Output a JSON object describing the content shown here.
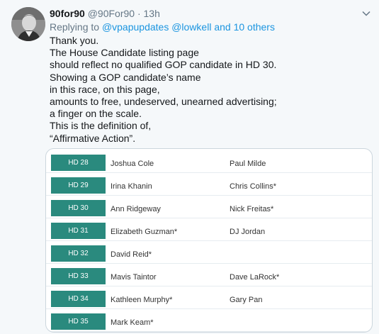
{
  "tweet": {
    "display_name": "90for90",
    "handle": "@90For90",
    "separator": "·",
    "time": "13h",
    "reply_prefix": "Replying to",
    "reply_users": "@vpapupdates @lowkell and 10 others",
    "lines": [
      "Thank you.",
      "The House Candidate listing page",
      "should reflect no qualified GOP candidate in HD 30.",
      "Showing a GOP candidate’s name",
      "in this race, on this page,",
      "amounts to free, undeserved, unearned advertising;",
      "a finger on the scale.",
      "This is the definition of,",
      "“Affirmative Action”."
    ],
    "icons": {
      "avatar": "avatar-photo",
      "menu": "chevron-down-icon"
    }
  },
  "table": {
    "badge_color": "#2a8a7e",
    "rows": [
      {
        "district": "HD 28",
        "candidate1": "Joshua Cole",
        "candidate2": "Paul Milde"
      },
      {
        "district": "HD 29",
        "candidate1": "Irina Khanin",
        "candidate2": "Chris Collins*"
      },
      {
        "district": "HD 30",
        "candidate1": "Ann Ridgeway",
        "candidate2": "Nick Freitas*"
      },
      {
        "district": "HD 31",
        "candidate1": "Elizabeth Guzman*",
        "candidate2": "DJ Jordan"
      },
      {
        "district": "HD 32",
        "candidate1": "David Reid*",
        "candidate2": ""
      },
      {
        "district": "HD 33",
        "candidate1": "Mavis Taintor",
        "candidate2": "Dave LaRock*"
      },
      {
        "district": "HD 34",
        "candidate1": "Kathleen Murphy*",
        "candidate2": "Gary Pan"
      },
      {
        "district": "HD 35",
        "candidate1": "Mark Keam*",
        "candidate2": ""
      }
    ]
  }
}
